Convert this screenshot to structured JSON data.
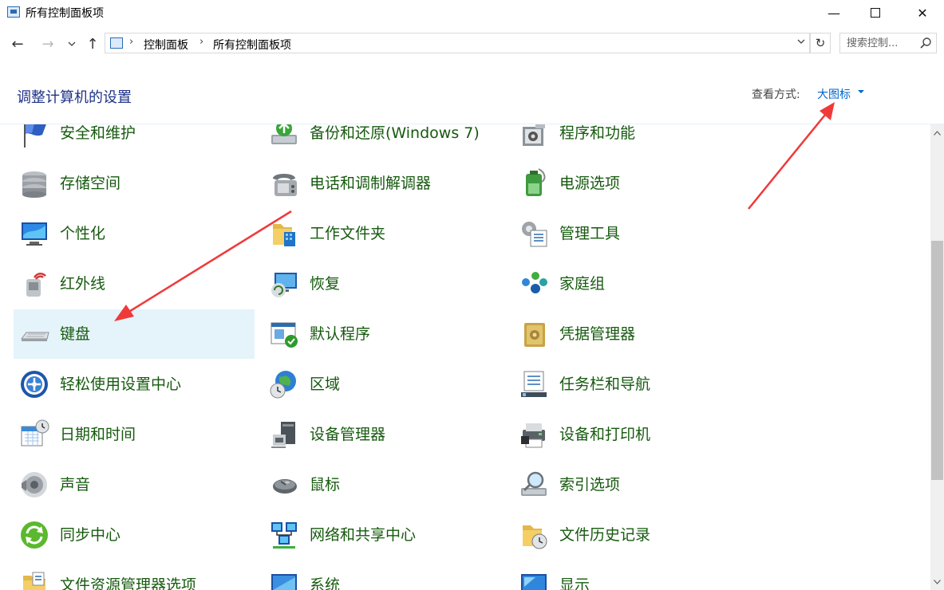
{
  "window": {
    "title": "所有控制面板项",
    "controls": {
      "minimize": "—",
      "maximize": "",
      "close": "✕"
    }
  },
  "nav": {
    "back": "←",
    "forward": "→",
    "recent": "⌄",
    "up": "↑"
  },
  "address": {
    "crumbs": [
      "控制面板",
      "所有控制面板项"
    ],
    "separator": "›"
  },
  "refresh": "↻",
  "search": {
    "placeholder": "搜索控制..."
  },
  "header": {
    "title": "调整计算机的设置",
    "view_label": "查看方式:",
    "view_value": "大图标"
  },
  "items": [
    {
      "label": "安全和维护",
      "icon": "flag-icon"
    },
    {
      "label": "备份和还原(Windows 7)",
      "icon": "backup-drive-icon"
    },
    {
      "label": "程序和功能",
      "icon": "program-box-icon"
    },
    {
      "label": "存储空间",
      "icon": "storage-disks-icon"
    },
    {
      "label": "电话和调制解调器",
      "icon": "telephone-icon"
    },
    {
      "label": "电源选项",
      "icon": "battery-icon"
    },
    {
      "label": "个性化",
      "icon": "monitor-paint-icon"
    },
    {
      "label": "工作文件夹",
      "icon": "work-folder-icon"
    },
    {
      "label": "管理工具",
      "icon": "admin-tools-icon"
    },
    {
      "label": "红外线",
      "icon": "infrared-icon"
    },
    {
      "label": "恢复",
      "icon": "recovery-monitor-icon"
    },
    {
      "label": "家庭组",
      "icon": "homegroup-icon"
    },
    {
      "label": "键盘",
      "icon": "keyboard-icon"
    },
    {
      "label": "默认程序",
      "icon": "default-programs-icon"
    },
    {
      "label": "凭据管理器",
      "icon": "vault-icon"
    },
    {
      "label": "轻松使用设置中心",
      "icon": "ease-of-access-icon"
    },
    {
      "label": "区域",
      "icon": "globe-clock-icon"
    },
    {
      "label": "任务栏和导航",
      "icon": "taskbar-icon"
    },
    {
      "label": "日期和时间",
      "icon": "calendar-clock-icon"
    },
    {
      "label": "设备管理器",
      "icon": "device-manager-icon"
    },
    {
      "label": "设备和打印机",
      "icon": "printer-icon"
    },
    {
      "label": "声音",
      "icon": "speaker-icon"
    },
    {
      "label": "鼠标",
      "icon": "mouse-icon"
    },
    {
      "label": "索引选项",
      "icon": "index-magnifier-icon"
    },
    {
      "label": "同步中心",
      "icon": "sync-icon"
    },
    {
      "label": "网络和共享中心",
      "icon": "network-icon"
    },
    {
      "label": "文件历史记录",
      "icon": "file-history-icon"
    },
    {
      "label": "文件资源管理器选项",
      "icon": "folder-options-icon"
    },
    {
      "label": "系统",
      "icon": "system-monitor-icon"
    },
    {
      "label": "显示",
      "icon": "display-icon"
    }
  ],
  "selected_item": "键盘",
  "colors": {
    "link_green": "#165a0e",
    "title_blue": "#1e3287",
    "link_blue": "#0066cc",
    "selection": "#e5f3fb",
    "annotation_arrow": "#f03a3a"
  }
}
